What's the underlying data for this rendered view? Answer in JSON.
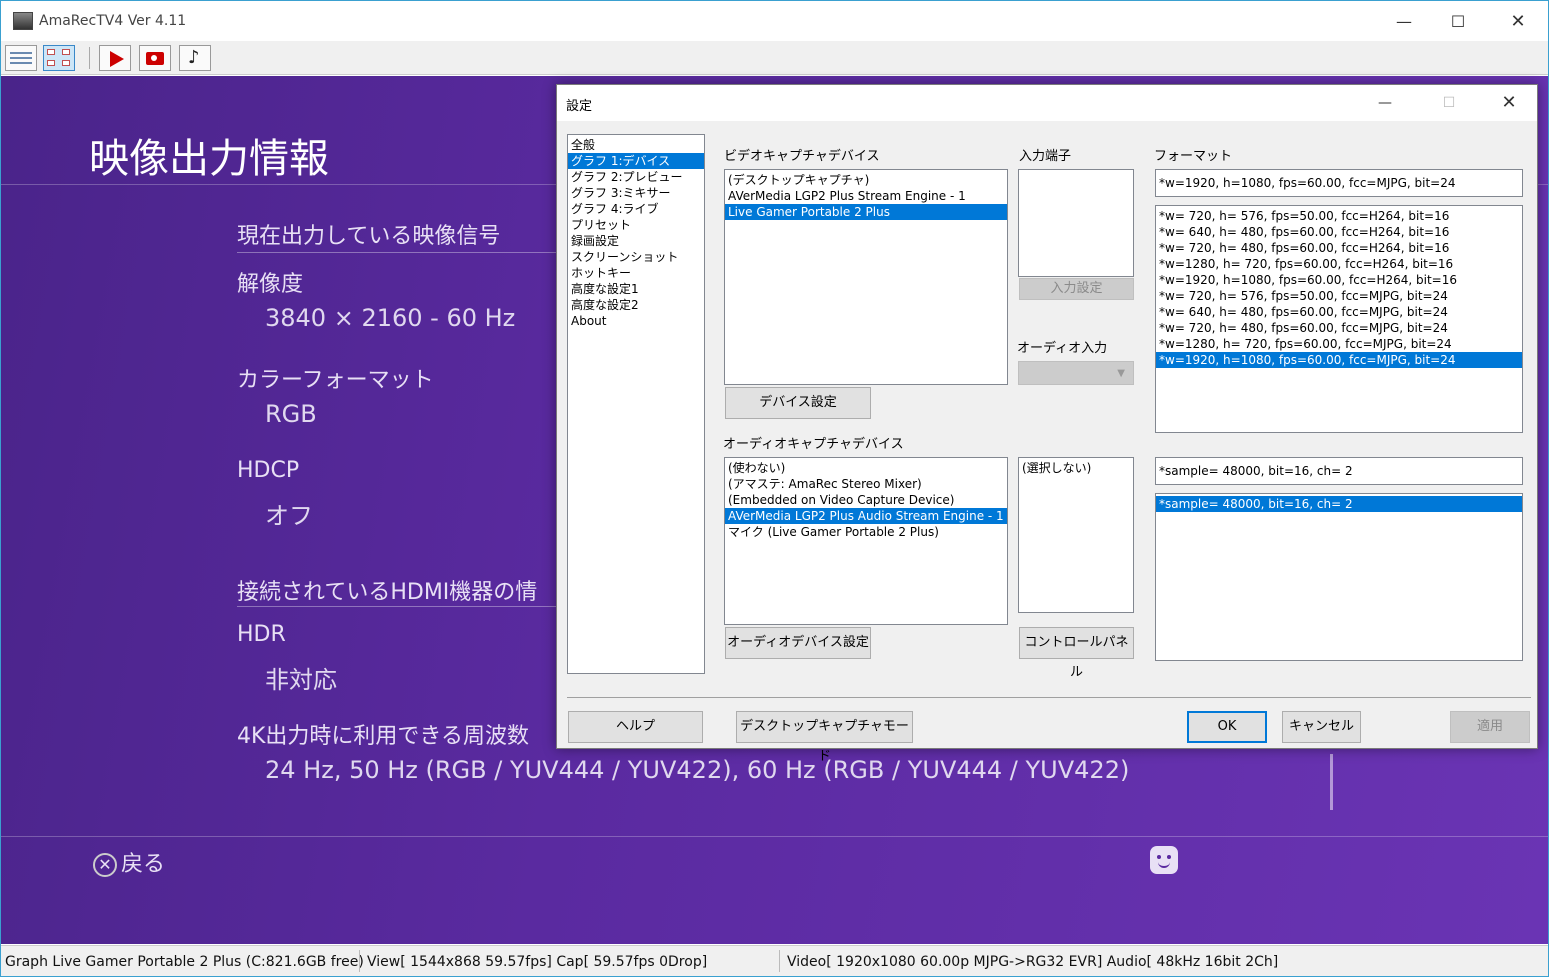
{
  "window": {
    "title": "AmaRecTV4 Ver 4.11",
    "minimize": "—",
    "maximize": "☐",
    "close": "✕"
  },
  "video": {
    "title": "映像出力情報",
    "section_current": "現在出力している映像信号",
    "resolution_label": "解像度",
    "resolution_value": "3840 × 2160 - 60 Hz",
    "color_format_label": "カラーフォーマット",
    "color_format_value": "RGB",
    "hdcp_label": "HDCP",
    "hdcp_value": "オフ",
    "section_connected": "接続されているHDMI機器の情",
    "hdr_label": "HDR",
    "hdr_value": "非対応",
    "freq_label": "4K出力時に利用できる周波数",
    "freq_value": "24 Hz, 50 Hz (RGB / YUV444 / YUV422), 60 Hz (RGB / YUV444 / YUV422)",
    "back_icon": "✕",
    "back_label": "戻る"
  },
  "status": {
    "graph": "Graph Live Gamer Portable 2 Plus  (C:821.6GB free)",
    "view": "View[ 1544x868 59.57fps]  Cap[ 59.57fps 0Drop]",
    "video": "Video[ 1920x1080 60.00p MJPG->RG32 EVR]  Audio[ 48kHz 16bit 2Ch]"
  },
  "dialog": {
    "title": "設定",
    "minimize": "—",
    "maximize": "☐",
    "close": "✕",
    "categories": [
      "全般",
      "グラフ 1:デバイス",
      "グラフ 2:プレビュー",
      "グラフ 3:ミキサー",
      "グラフ 4:ライブ",
      "プリセット",
      "録画設定",
      "スクリーンショット",
      "ホットキー",
      "高度な設定1",
      "高度な設定2",
      "About"
    ],
    "video_device_label": "ビデオキャプチャデバイス",
    "video_devices": [
      "(デスクトップキャプチャ)",
      "AVerMedia LGP2 Plus Stream Engine - 1",
      "Live Gamer Portable 2 Plus"
    ],
    "device_settings_button": "デバイス設定",
    "input_terminal_label": "入力端子",
    "input_settings_button": "入力設定",
    "audio_input_label": "オーディオ入力",
    "format_label": "フォーマット",
    "format_current": "*w=1920, h=1080, fps=60.00,  fcc=MJPG, bit=24",
    "formats": [
      "*w= 720, h= 576, fps=50.00,  fcc=H264, bit=16",
      "*w= 640, h= 480, fps=60.00,  fcc=H264, bit=16",
      "*w= 720, h= 480, fps=60.00,  fcc=H264, bit=16",
      "*w=1280, h= 720, fps=60.00,  fcc=H264, bit=16",
      "*w=1920, h=1080, fps=60.00,  fcc=H264, bit=16",
      "*w= 720, h= 576, fps=50.00,  fcc=MJPG, bit=24",
      "*w= 640, h= 480, fps=60.00,  fcc=MJPG, bit=24",
      "*w= 720, h= 480, fps=60.00,  fcc=MJPG, bit=24",
      "*w=1280, h= 720, fps=60.00,  fcc=MJPG, bit=24",
      "*w=1920, h=1080, fps=60.00,  fcc=MJPG, bit=24"
    ],
    "audio_device_label": "オーディオキャプチャデバイス",
    "audio_devices": [
      "(使わない)",
      "(アマステ: AmaRec Stereo Mixer)",
      "(Embedded on Video Capture Device)",
      "AVerMedia LGP2 Plus Audio Stream Engine - 1",
      "マイク (Live Gamer Portable 2 Plus)"
    ],
    "audio_device_settings_button": "オーディオデバイス設定",
    "audio_inputs": [
      "(選択しない)"
    ],
    "control_panel_button": "コントロールパネル",
    "audio_format_current": "*sample= 48000, bit=16, ch= 2",
    "audio_formats": [
      "*sample= 48000, bit=16, ch= 2"
    ],
    "help_button": "ヘルプ",
    "desktop_capture_button": "デスクトップキャプチャモード",
    "ok_button": "OK",
    "cancel_button": "キャンセル",
    "apply_button": "適用"
  }
}
